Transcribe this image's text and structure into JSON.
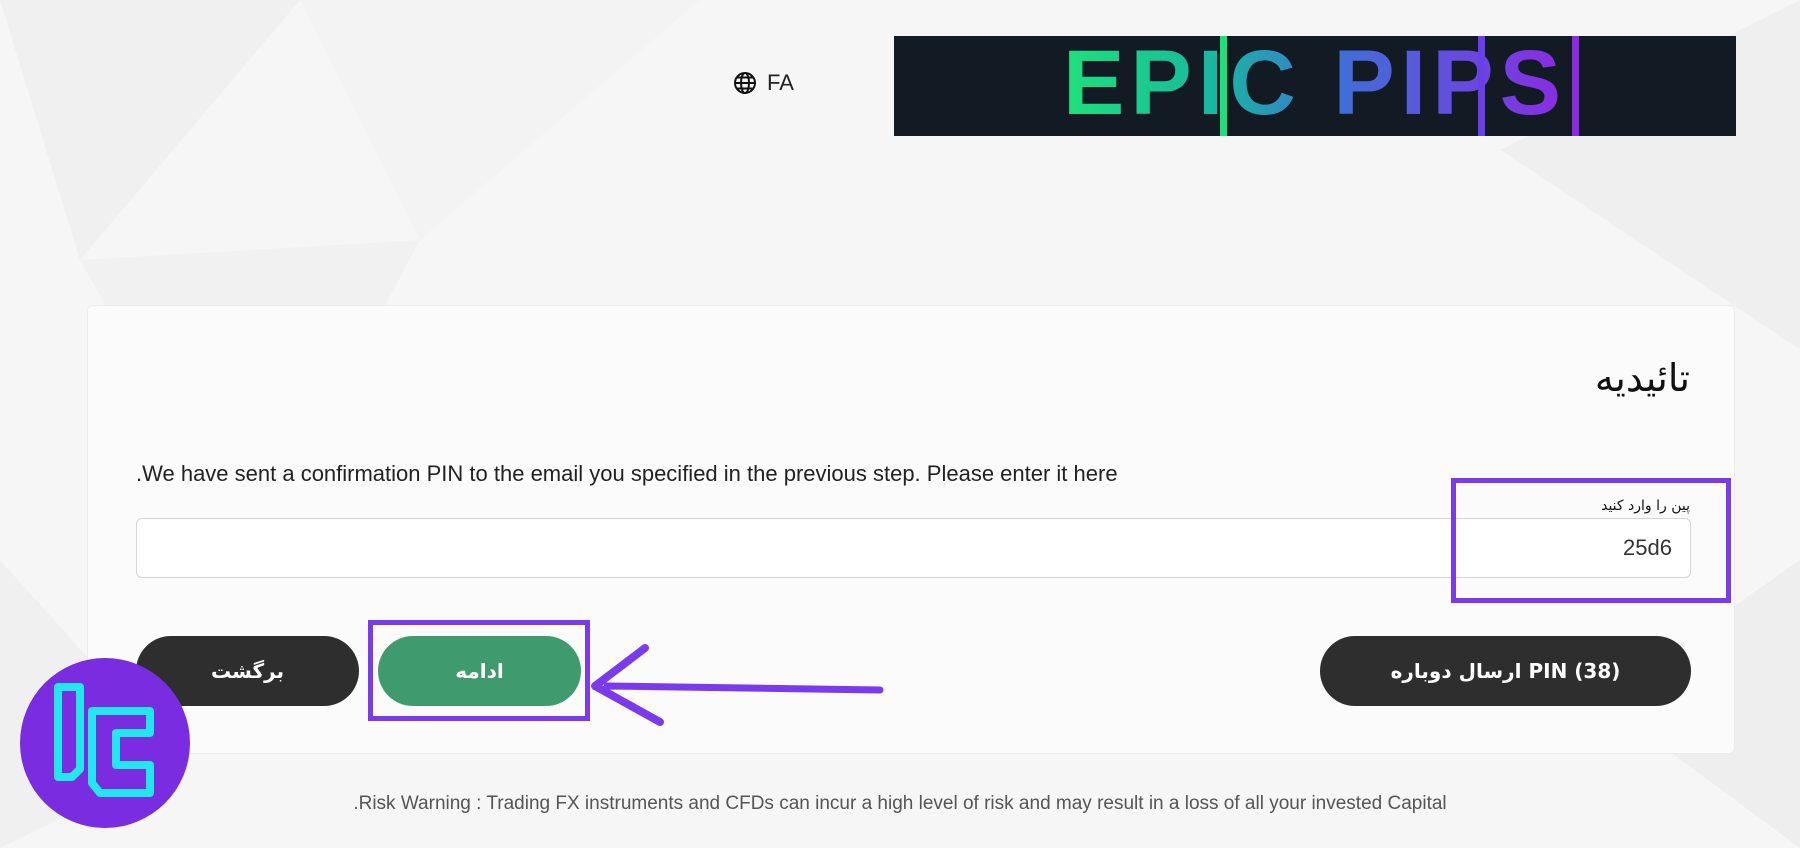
{
  "header": {
    "language_label": "FA",
    "language_icon": "globe-icon",
    "logo_text": "EPIC PIPS"
  },
  "card": {
    "title": "تائیدیه",
    "instruction": ".We have sent a confirmation PIN to the email you specified in the previous step. Please enter it here",
    "pin_label": "پین را وارد کنید",
    "pin_value": "25d6",
    "back_label": "برگشت",
    "continue_label": "ادامه",
    "resend_label": "ارسال دوباره PIN (38)"
  },
  "footer": {
    "risk_warning": ".Risk Warning : Trading FX instruments and CFDs can incur a high level of risk and may result in a loss of all your invested Capital"
  },
  "colors": {
    "accent_highlight": "#7c3aed",
    "continue_button": "#3f9a6e",
    "dark_button": "#2e2e2e",
    "logo_bg": "#121b24"
  }
}
